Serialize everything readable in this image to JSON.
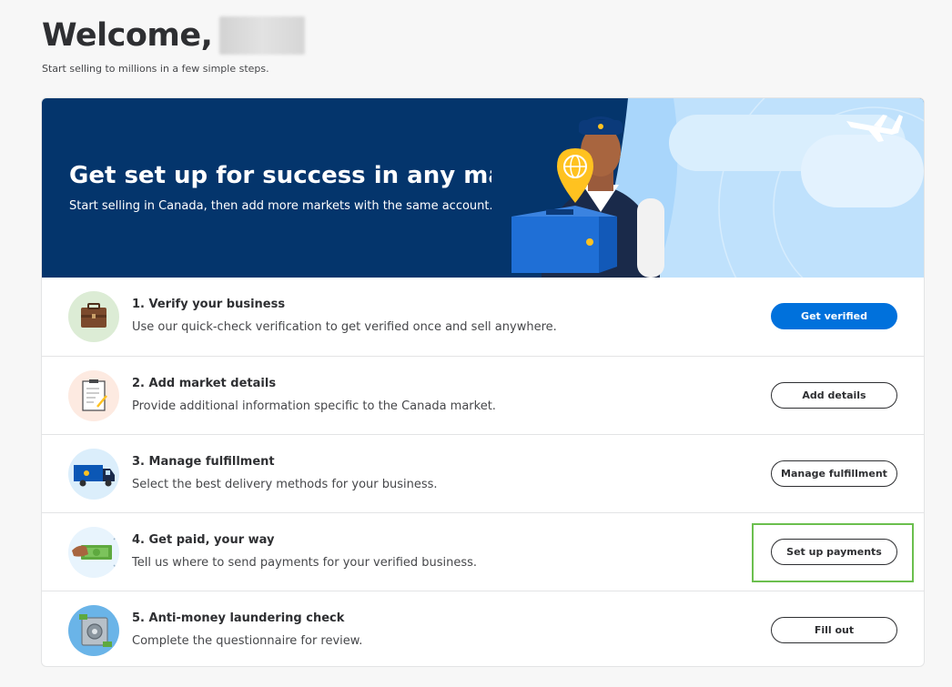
{
  "header": {
    "welcome": "Welcome,",
    "subtitle": "Start selling to millions in a few simple steps."
  },
  "banner": {
    "title": "Get set up for success in any market",
    "subtitle": "Start selling in Canada, then add more markets with the same account."
  },
  "steps": [
    {
      "title": "1. Verify your business",
      "description": "Use our quick-check verification to get verified once and sell anywhere.",
      "button": "Get verified",
      "icon": "briefcase-icon"
    },
    {
      "title": "2. Add market details",
      "description": "Provide additional information specific to the Canada market.",
      "button": "Add details",
      "icon": "clipboard-icon"
    },
    {
      "title": "3. Manage fulfillment",
      "description": "Select the best delivery methods for your business.",
      "button": "Manage fulfillment",
      "icon": "truck-icon"
    },
    {
      "title": "4. Get paid, your way",
      "description": "Tell us where to send payments for your verified business.",
      "button": "Set up payments",
      "icon": "money-icon"
    },
    {
      "title": "5. Anti-money laundering check",
      "description": "Complete the questionnaire for review.",
      "button": "Fill out",
      "icon": "safe-icon"
    }
  ],
  "colors": {
    "primary": "#0071dc",
    "banner_bg": "#04356c",
    "highlight": "#6bbf4e"
  }
}
